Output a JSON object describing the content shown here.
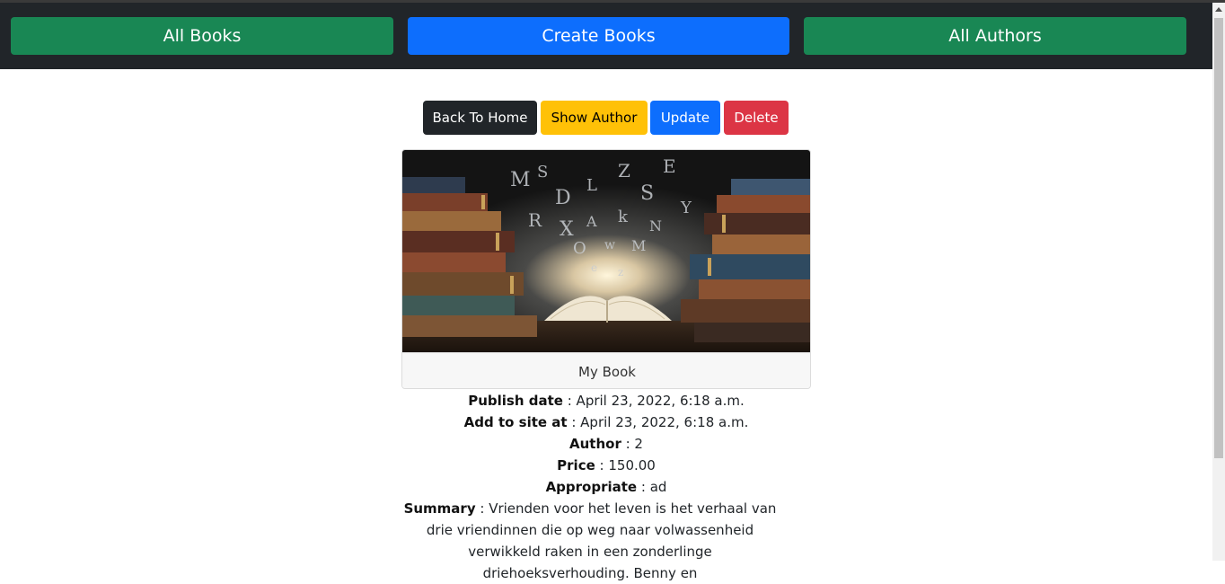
{
  "nav": {
    "all_books": "All Books",
    "create_books": "Create Books",
    "all_authors": "All Authors"
  },
  "actions": {
    "back_home": "Back To Home",
    "show_author": "Show Author",
    "update": "Update",
    "delete": "Delete"
  },
  "book": {
    "title": "My Book",
    "image_icon": "book-letters-image",
    "fields": {
      "publish_date_label": "Publish date",
      "publish_date_value": " : April 23, 2022, 6:18 a.m.",
      "added_label": "Add to site at",
      "added_value": " : April 23, 2022, 6:18 a.m.",
      "author_label": "Author",
      "author_value": " : 2",
      "price_label": "Price",
      "price_value": " : 150.00",
      "appropriate_label": "Appropriate",
      "appropriate_value": " : ad",
      "summary_label": "Summary",
      "summary_value": " : Vrienden voor het leven is het verhaal van drie vriendinnen die op weg naar volwassenheid verwikkeld raken in een zonderlinge driehoeksverhouding. Benny en"
    }
  },
  "colors": {
    "navbar": "#212529",
    "success": "#198754",
    "primary": "#0d6efd",
    "warning": "#ffc107",
    "danger": "#dc3545",
    "dark": "#212529"
  }
}
